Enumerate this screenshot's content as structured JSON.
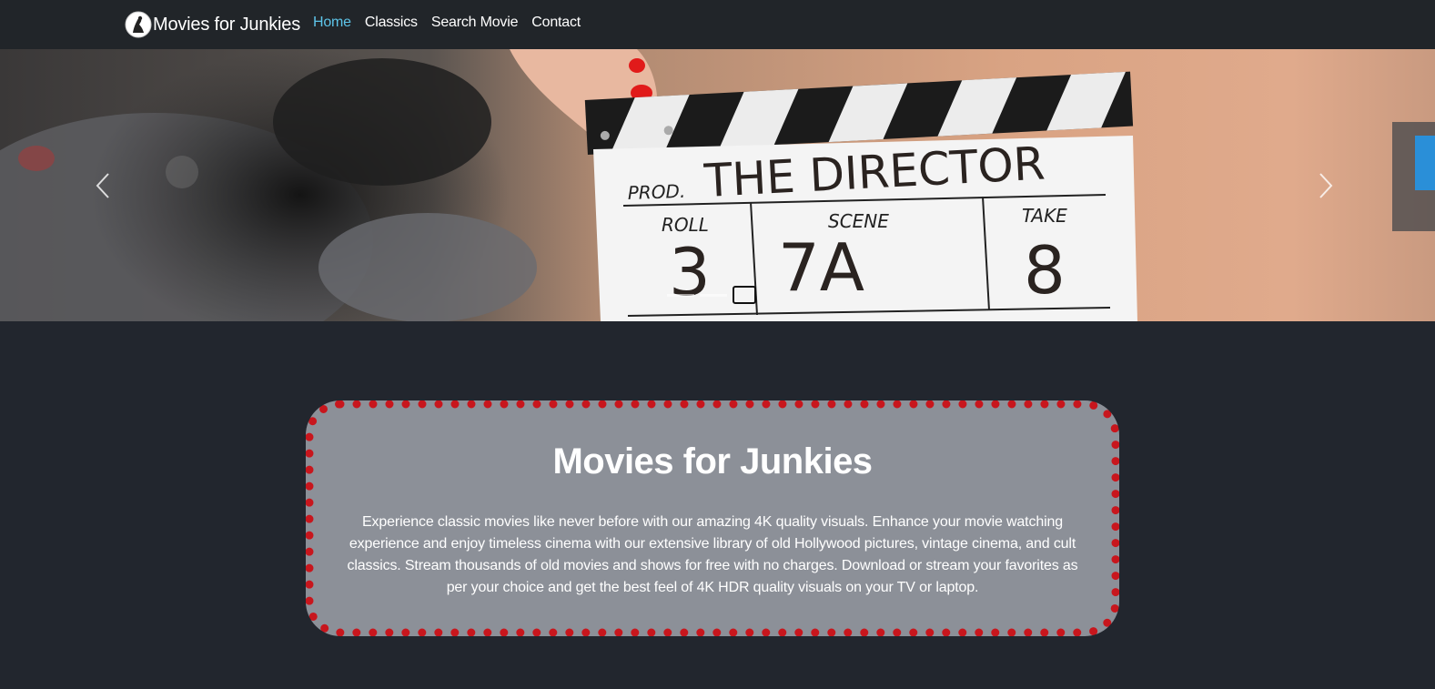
{
  "navbar": {
    "brand": "Movies for Junkies",
    "links": [
      {
        "label": "Home",
        "active": true
      },
      {
        "label": "Classics",
        "active": false
      },
      {
        "label": "Search Movie",
        "active": false
      },
      {
        "label": "Contact",
        "active": false
      }
    ]
  },
  "carousel": {
    "slate": {
      "prod_label": "PROD.",
      "title": "THE DIRECTOR",
      "roll_label": "ROLL",
      "roll_value": "3",
      "scene_label": "SCENE",
      "scene_value": "7A",
      "take_label": "TAKE",
      "take_value": "8"
    },
    "prev_icon": "chevron-left-icon",
    "next_icon": "chevron-right-icon",
    "slide_count": 2,
    "active_slide": 1
  },
  "hero": {
    "title": "Movies for Junkies",
    "description": "Experience classic movies like never before with our amazing 4K quality visuals. Enhance your movie watching experience and enjoy timeless cinema with our extensive library of old Hollywood pictures, vintage cinema, and cult classics. Stream thousands of old movies and shows for free with no charges. Download or stream your favorites as per your choice and get the best feel of 4K HDR quality visuals on your TV or laptop."
  },
  "colors": {
    "page_bg": "#22262e",
    "navbar_bg": "#212529",
    "active_link": "#5dc4e8",
    "card_bg": "#8c9098",
    "card_border": "#c8161d"
  }
}
